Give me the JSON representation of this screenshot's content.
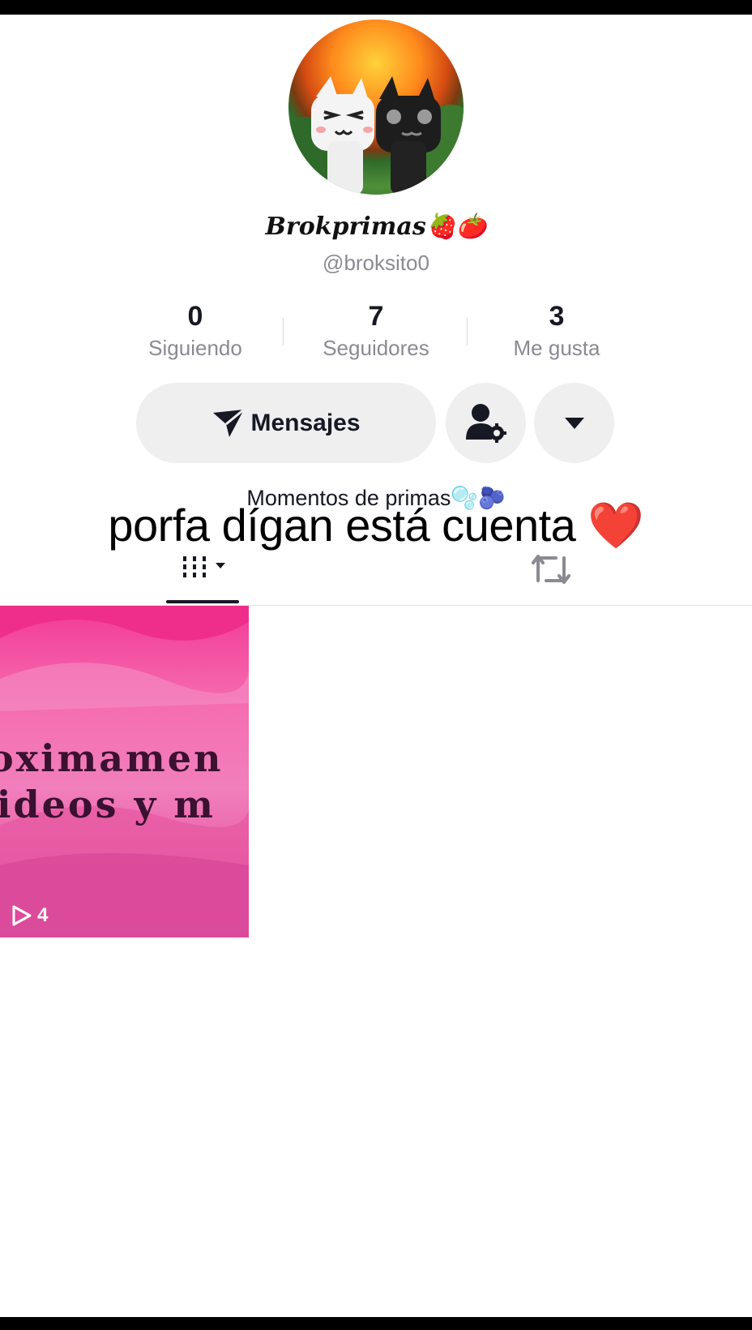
{
  "profile": {
    "display_name": "Brokprimas🍓🍅",
    "username": "@broksito0",
    "bio": "Momentos de primas🫧🫐"
  },
  "stats": [
    {
      "value": "0",
      "label": "Siguiendo"
    },
    {
      "value": "7",
      "label": "Seguidores"
    },
    {
      "value": "3",
      "label": "Me gusta"
    }
  ],
  "actions": {
    "message_label": "Mensajes"
  },
  "overlay": {
    "caption": "porfa dígan está cuenta ❤️"
  },
  "tabs": [
    {
      "icon": "videos-grid-icon",
      "active": true
    },
    {
      "icon": "repost-icon",
      "active": false
    }
  ],
  "videos": [
    {
      "thumbnail_text_line1": "oximamen",
      "thumbnail_text_line2": "ideos y m",
      "play_count": "4",
      "colors": {
        "bg": "#f23a95"
      }
    }
  ],
  "colors": {
    "text_primary": "#161823",
    "text_secondary": "#8a8b91",
    "button_bg": "#efeff0"
  }
}
